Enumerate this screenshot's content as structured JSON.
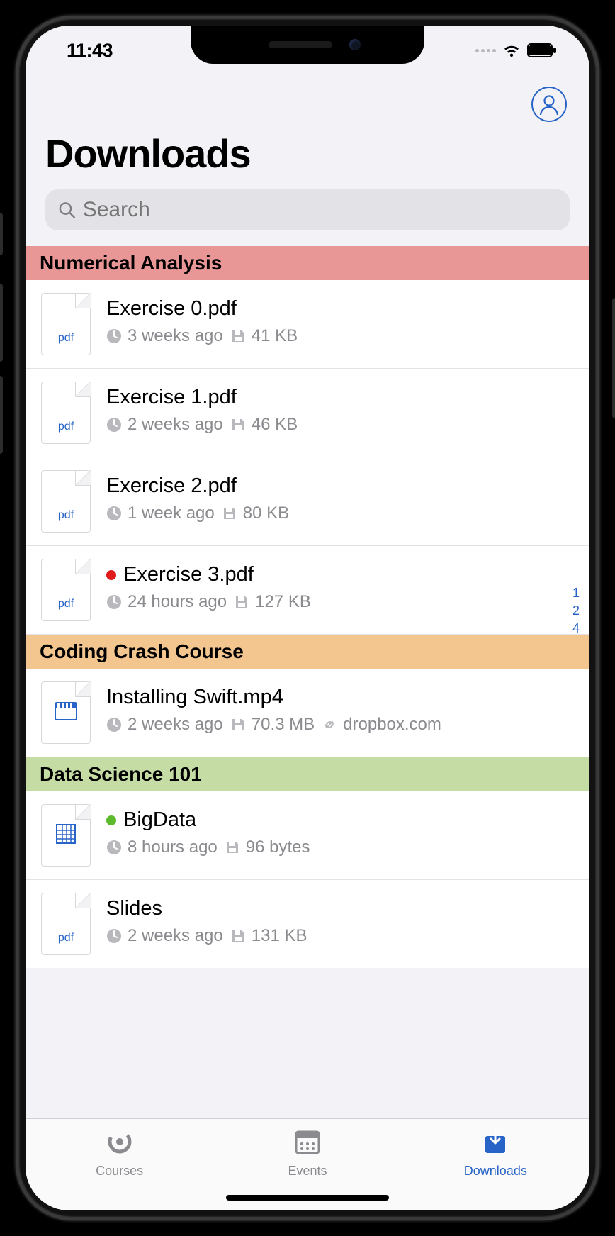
{
  "status": {
    "time": "11:43"
  },
  "header": {
    "title": "Downloads"
  },
  "search": {
    "placeholder": "Search"
  },
  "index_rail": [
    "1",
    "2",
    "4"
  ],
  "sections": [
    {
      "title": "Numerical Analysis",
      "color": "#e99696",
      "files": [
        {
          "name": "Exercise 0.pdf",
          "type": "pdf",
          "age": "3 weeks ago",
          "size": "41 KB",
          "dot": null,
          "source": null
        },
        {
          "name": "Exercise 1.pdf",
          "type": "pdf",
          "age": "2 weeks ago",
          "size": "46 KB",
          "dot": null,
          "source": null
        },
        {
          "name": "Exercise 2.pdf",
          "type": "pdf",
          "age": "1 week ago",
          "size": "80 KB",
          "dot": null,
          "source": null
        },
        {
          "name": "Exercise 3.pdf",
          "type": "pdf",
          "age": "24 hours ago",
          "size": "127 KB",
          "dot": "#e11b1b",
          "source": null
        }
      ]
    },
    {
      "title": "Coding Crash Course",
      "color": "#f3c690",
      "files": [
        {
          "name": "Installing Swift.mp4",
          "type": "video",
          "age": "2 weeks ago",
          "size": "70.3 MB",
          "dot": null,
          "source": "dropbox.com"
        }
      ]
    },
    {
      "title": "Data Science 101",
      "color": "#c5dca4",
      "files": [
        {
          "name": "BigData",
          "type": "sheet",
          "age": "8 hours ago",
          "size": "96 bytes",
          "dot": "#5cbb2c",
          "source": null
        },
        {
          "name": "Slides",
          "type": "pdf",
          "age": "2 weeks ago",
          "size": "131 KB",
          "dot": null,
          "source": null
        }
      ]
    }
  ],
  "tabs": [
    {
      "id": "courses",
      "label": "Courses",
      "active": false
    },
    {
      "id": "events",
      "label": "Events",
      "active": false
    },
    {
      "id": "downloads",
      "label": "Downloads",
      "active": true
    }
  ]
}
